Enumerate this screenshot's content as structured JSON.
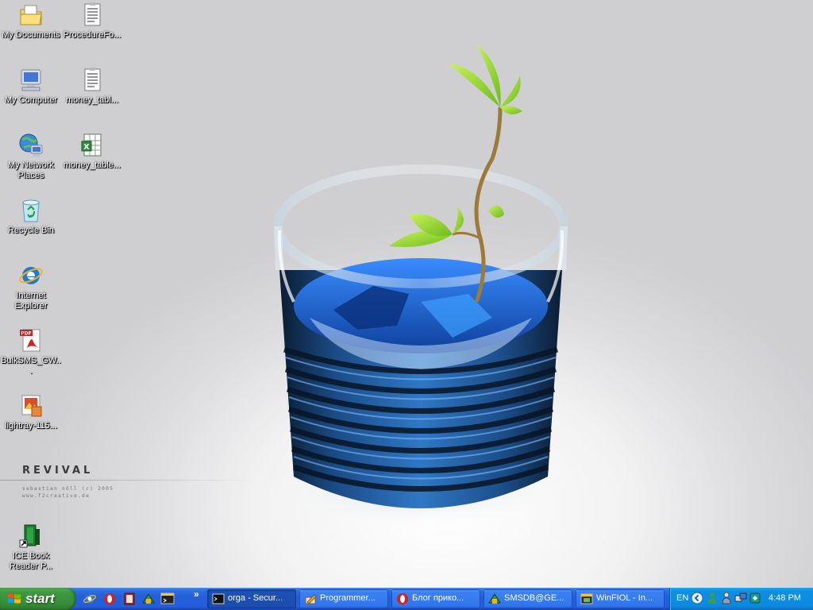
{
  "desktop": {
    "icons": [
      {
        "label": "My Documents"
      },
      {
        "label": "ProcedureFo..."
      },
      {
        "label": "My Computer"
      },
      {
        "label": "money_tabl..."
      },
      {
        "label": "My Network Places"
      },
      {
        "label": "money_table..."
      },
      {
        "label": "Recycle Bin"
      },
      {
        "label": "Internet Explorer"
      },
      {
        "label": "BulkSMS_GW..."
      },
      {
        "label": "lightray-115..."
      },
      {
        "label": "ICE Book Reader P..."
      }
    ]
  },
  "wallpaper": {
    "brand": "REVIVAL",
    "credit": "sebastian nöll (c) 2005",
    "url": "www.f2creative.de"
  },
  "taskbar": {
    "start_label": "start",
    "quick_launch_overflow": "»",
    "tasks": [
      {
        "label": "orga - Secur...",
        "icon": "terminal-icon",
        "active": true
      },
      {
        "label": "Programmer...",
        "icon": "pencil-icon",
        "active": false
      },
      {
        "label": "Блог прико...",
        "icon": "opera-icon",
        "active": false
      },
      {
        "label": "SMSDB@GE...",
        "icon": "database-icon",
        "active": false
      },
      {
        "label": "WinFIOL - In...",
        "icon": "app-window-icon",
        "active": false
      }
    ],
    "tray": {
      "language": "EN",
      "clock": "4:48 PM"
    }
  }
}
